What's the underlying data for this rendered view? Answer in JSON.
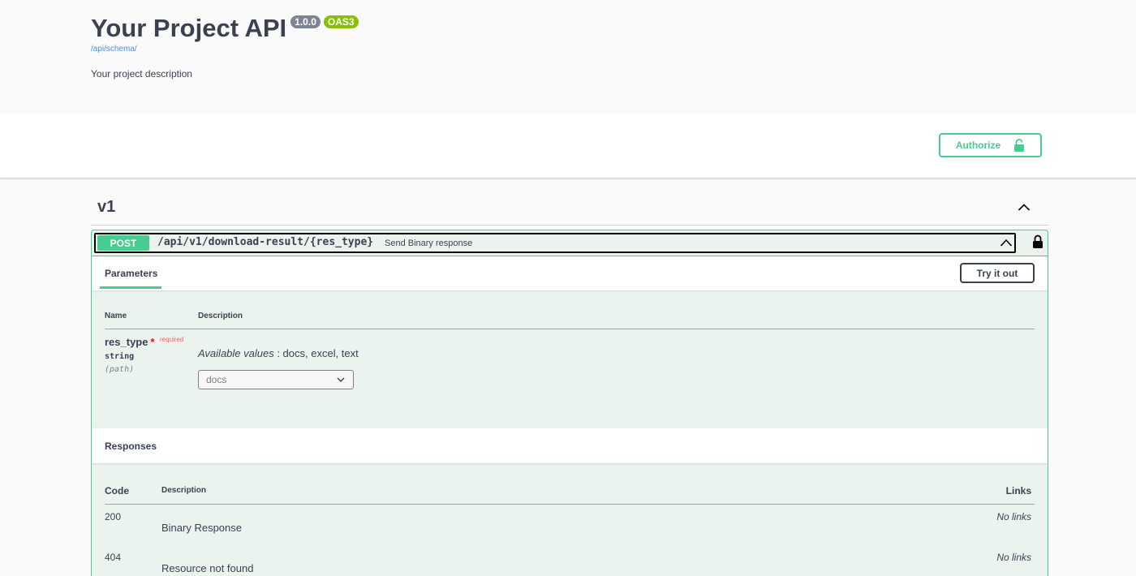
{
  "info": {
    "title": "Your Project API",
    "version": "1.0.0",
    "oas": "OAS3",
    "schema_link": "/api/schema/",
    "description": "Your project description"
  },
  "auth": {
    "authorize_label": "Authorize"
  },
  "tag": {
    "name": "v1"
  },
  "operation": {
    "method": "POST",
    "path": "/api/v1/download-result/{res_type}",
    "summary": "Send Binary response",
    "parameters_tab": "Parameters",
    "try_label": "Try it out",
    "param_headers": {
      "name": "Name",
      "description": "Description"
    },
    "param": {
      "name": "res_type",
      "star": "*",
      "required": "required",
      "type": "string",
      "in": "(path)",
      "available_label": "Available values",
      "available_values": " : docs, excel, text",
      "selected": "docs"
    },
    "responses_title": "Responses",
    "response_headers": {
      "code": "Code",
      "description": "Description",
      "links": "Links"
    },
    "responses": [
      {
        "code": "200",
        "description": "Binary Response",
        "links": "No links"
      },
      {
        "code": "404",
        "description": "Resource not found",
        "links": "No links"
      }
    ]
  },
  "colors": {
    "post_green": "#49cc90",
    "op_background": "#ebf3ef",
    "text": "#3b4151",
    "version_badge": "#7d8492",
    "oas_badge": "#89bf04",
    "link_blue": "#4990e2",
    "required_red": "#ff0000"
  },
  "icons": {
    "authorize": "unlocked-padlock-icon",
    "tag_toggle": "chevron-up-icon",
    "op_toggle": "chevron-up-icon",
    "op_lock": "locked-padlock-icon",
    "select": "chevron-down-icon"
  }
}
